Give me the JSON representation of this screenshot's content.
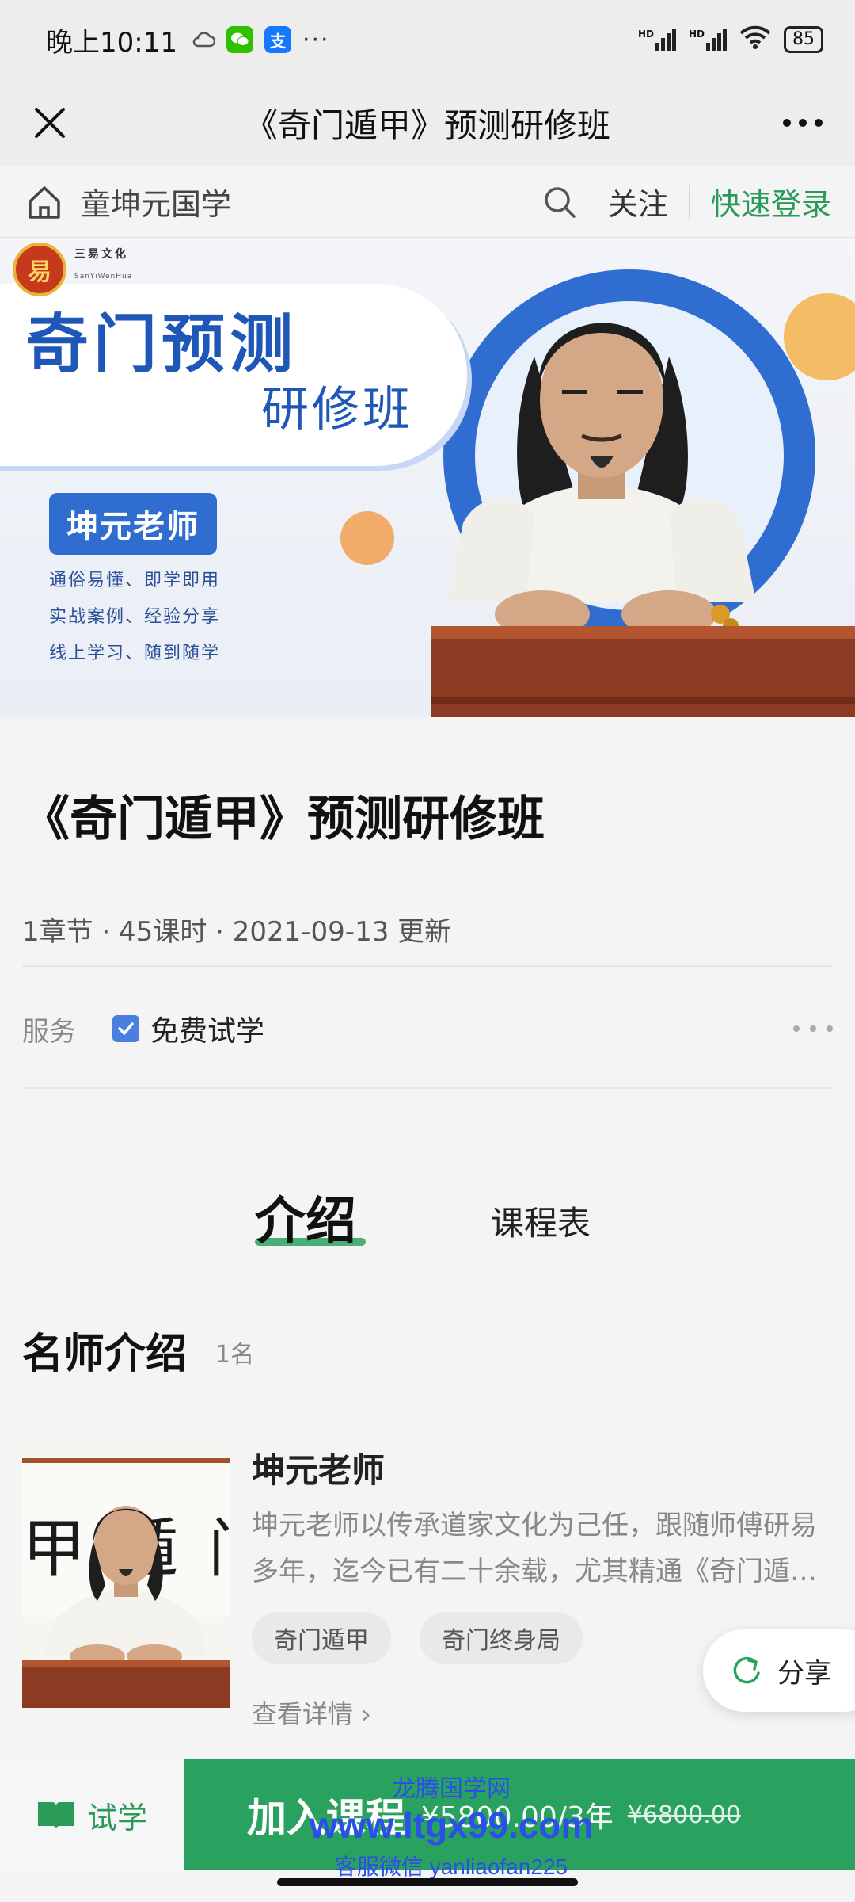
{
  "status_bar": {
    "time": "晚上10:11",
    "more": "···",
    "signal1": "HD",
    "signal2": "HD",
    "battery": "85"
  },
  "title_bar": {
    "title": "《奇门遁甲》预测研修班"
  },
  "site_bar": {
    "name": "童坤元国学",
    "follow": "关注",
    "login": "快速登录"
  },
  "banner": {
    "brand": "三易文化",
    "brand_sub": "SanYiWenHua",
    "headline": "奇门预测",
    "subheadline": "研修班",
    "teacher_badge": "坤元老师",
    "features": [
      "通俗易懂、即学即用",
      "实战案例、经验分享",
      "线上学习、随到随学"
    ]
  },
  "course": {
    "title": "《奇门遁甲》预测研修班",
    "meta": "1章节 · 45课时 · 2021-09-13 更新",
    "service_label": "服务",
    "service_item": "免费试学"
  },
  "tabs": {
    "intro": "介绍",
    "schedule": "课程表"
  },
  "teachers_section": {
    "title": "名师介绍",
    "count": "1名",
    "teacher": {
      "name": "坤元老师",
      "description": "坤元老师以传承道家文化为己任，跟随师傅研易多年，迄今已有二十余载，尤其精通《奇门遁…",
      "tags": [
        "奇门遁甲",
        "奇门终身局"
      ],
      "detail_link": "查看详情 ›",
      "photo_calligraphy": "甲 遁 门 奇"
    }
  },
  "share": {
    "label": "分享"
  },
  "bottom_bar": {
    "trial_label": "试学",
    "join_label": "加入课程",
    "price": "¥5800.00/3年",
    "original_price": "¥6800.00"
  },
  "watermark": {
    "line1": "龙腾国学网",
    "line2": "www.ltgx99.com",
    "line3": "客服微信 yanliaofan225"
  },
  "colors": {
    "accent_green": "#2aa25f",
    "banner_blue": "#1f57b8",
    "watermark_blue": "#2a50e8"
  }
}
